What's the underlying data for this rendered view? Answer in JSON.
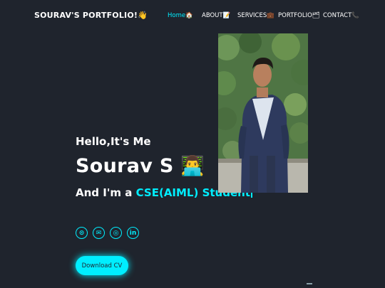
{
  "navbar": {
    "logo": "SOURAV'S PORTFOLIO!👋",
    "links": [
      {
        "label": "Home🏠",
        "active": true
      },
      {
        "label": "ABOUT📝"
      },
      {
        "label": "SERVICES💼"
      },
      {
        "label": "PORTFOLIO🗂"
      },
      {
        "label": "CONTACT📞"
      }
    ]
  },
  "hero": {
    "greeting": "Hello,It's Me",
    "name": "Sourav S 👨‍💻",
    "role_prefix": "And I'm a ",
    "role_text": "CSE(AIML) Student"
  },
  "socials": [
    {
      "name": "github-icon",
      "glyph": "⊙"
    },
    {
      "name": "email-icon",
      "glyph": "✉"
    },
    {
      "name": "instagram-icon",
      "glyph": "◎"
    },
    {
      "name": "linkedin-icon",
      "glyph": "in"
    }
  ],
  "download_button": "Download CV",
  "colors": {
    "background": "#1f242d",
    "accent": "#00eeff",
    "text": "#ffffff"
  }
}
